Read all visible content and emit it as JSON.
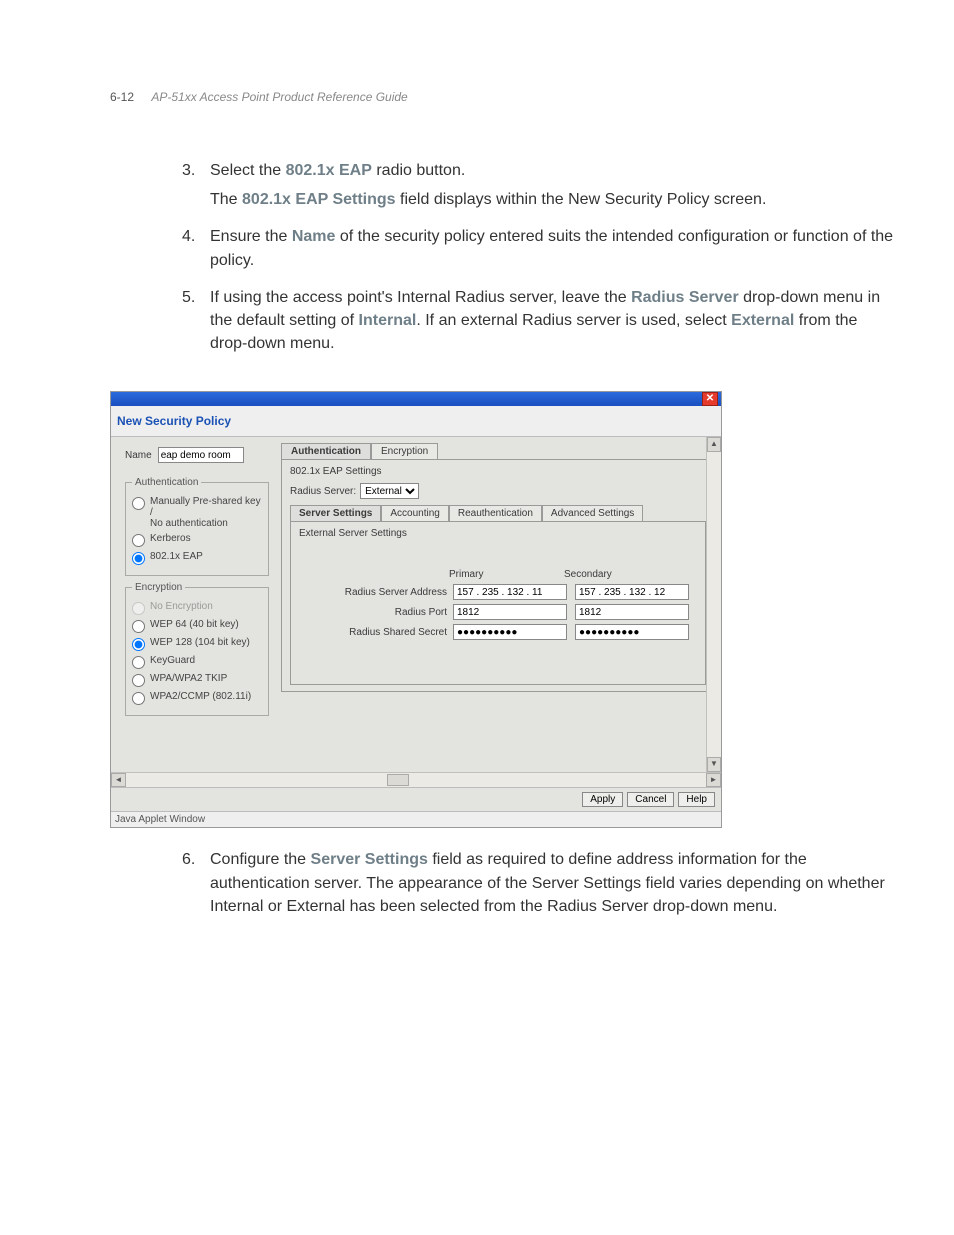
{
  "header": {
    "pageno": "6-12",
    "title": "AP-51xx Access Point Product Reference Guide"
  },
  "steps": {
    "s3": {
      "num": "3.",
      "p1a": "Select the ",
      "p1link": "802.1x EAP",
      "p1b": " radio button.",
      "p2a": "The ",
      "p2link": "802.1x EAP Settings",
      "p2b": " field displays within the New Security Policy screen."
    },
    "s4": {
      "num": "4.",
      "p1a": "Ensure the ",
      "p1link": "Name",
      "p1b": " of the security policy entered suits the intended configuration or function of the policy."
    },
    "s5": {
      "num": "5.",
      "p1a": "If using the access point's Internal Radius server, leave the ",
      "p1link": "Radius Server",
      "p1b": " drop-down menu in the default setting of ",
      "p1link2": "Internal",
      "p1c": ". If an external Radius server is used, select ",
      "p1link3": "External",
      "p1d": " from the drop-down menu."
    },
    "s6": {
      "num": "6.",
      "p1a": "Configure the ",
      "p1link": "Server Settings",
      "p1b": " field as required to define address information for the authentication server. The appearance of the Server Settings field varies depending on whether Internal or External has been selected from the Radius Server drop-down menu."
    }
  },
  "shot": {
    "closeText": "✕",
    "heading": "New Security Policy",
    "nameLabel": "Name",
    "nameValue": "eap demo room",
    "authLegend": "Authentication",
    "auth": {
      "opt1a": "Manually Pre-shared key /",
      "opt1b": "No authentication",
      "opt2": "Kerberos",
      "opt3": "802.1x EAP"
    },
    "encLegend": "Encryption",
    "enc": {
      "opt1": "No Encryption",
      "opt2": "WEP 64 (40 bit key)",
      "opt3": "WEP 128 (104 bit key)",
      "opt4": "KeyGuard",
      "opt5": "WPA/WPA2 TKIP",
      "opt6": "WPA2/CCMP (802.11i)"
    },
    "topTabs": {
      "t1": "Authentication",
      "t2": "Encryption"
    },
    "eapTitle": "802.1x EAP Settings",
    "radiusLabel": "Radius Server:",
    "radiusSel": "External",
    "subTabs": {
      "t1": "Server Settings",
      "t2": "Accounting",
      "t3": "Reauthentication",
      "t4": "Advanced Settings"
    },
    "extTitle": "External Server Settings",
    "colPrimary": "Primary",
    "colSecondary": "Secondary",
    "rowAddrLabel": "Radius Server Address",
    "rowAddrP": "157 . 235 . 132 . 11",
    "rowAddrS": "157 . 235 . 132 . 12",
    "rowPortLabel": "Radius Port",
    "rowPortP": "1812",
    "rowPortS": "1812",
    "rowSecretLabel": "Radius Shared Secret",
    "rowSecretP": "●●●●●●●●●●",
    "rowSecretS": "●●●●●●●●●●",
    "btnApply": "Apply",
    "btnCancel": "Cancel",
    "btnHelp": "Help",
    "javaLabel": "Java Applet Window",
    "upArrow": "▲",
    "downArrow": "▼",
    "leftArrow": "◄",
    "rightArrow": "►"
  }
}
